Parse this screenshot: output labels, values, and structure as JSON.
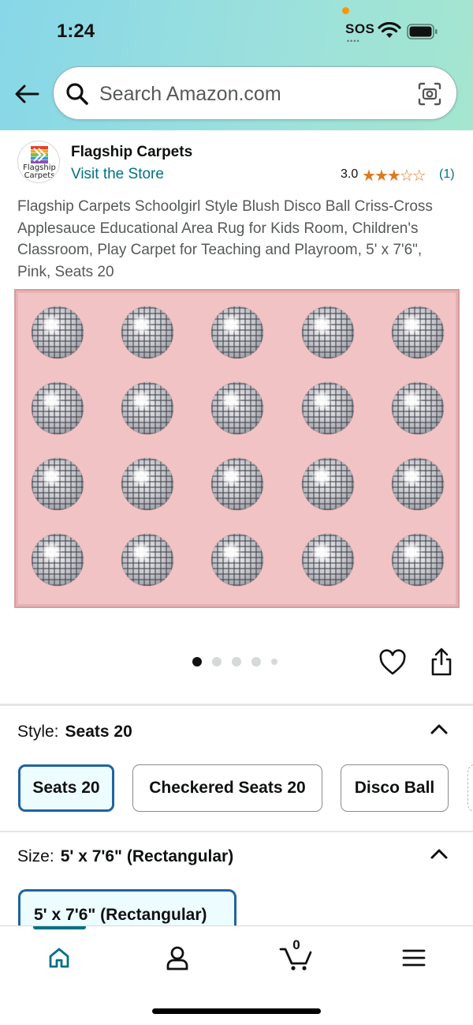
{
  "status_bar": {
    "time": "1:24",
    "sos": "SOS",
    "sos_dots": "••••"
  },
  "header": {
    "search_placeholder": "Search Amazon.com",
    "icons": [
      "back-arrow-icon",
      "search-icon",
      "camera-icon"
    ]
  },
  "brand": {
    "logo_text": "Flagship\nCarpets",
    "name": "Flagship Carpets",
    "visit_store": "Visit the Store",
    "rating": "3.0",
    "rating_count": "(1)",
    "stars": 3,
    "star_color": "#de7921"
  },
  "product": {
    "title": "Flagship Carpets Schoolgirl Style Blush Disco Ball Criss-Cross Applesauce Educational Area Rug for Kids Room, Children's Classroom, Play Carpet for Teaching and Playroom, 5' x 7'6\", Pink, Seats 20",
    "image_count": 5,
    "active_image": 1,
    "rug_color": "#f2c3c5"
  },
  "style": {
    "label": "Style:",
    "value": "Seats 20",
    "options": [
      "Seats 20",
      "Checkered Seats 20",
      "Disco Ball"
    ],
    "selected": "Seats 20"
  },
  "size": {
    "label": "Size:",
    "value": "5' x 7'6\" (Rectangular)",
    "option": "5' x 7'6\" (Rectangular)"
  },
  "tabbar": {
    "tabs": [
      "home-icon",
      "account-icon",
      "cart-icon",
      "menu-icon"
    ],
    "cart_count": "0",
    "accent": "#007185"
  }
}
